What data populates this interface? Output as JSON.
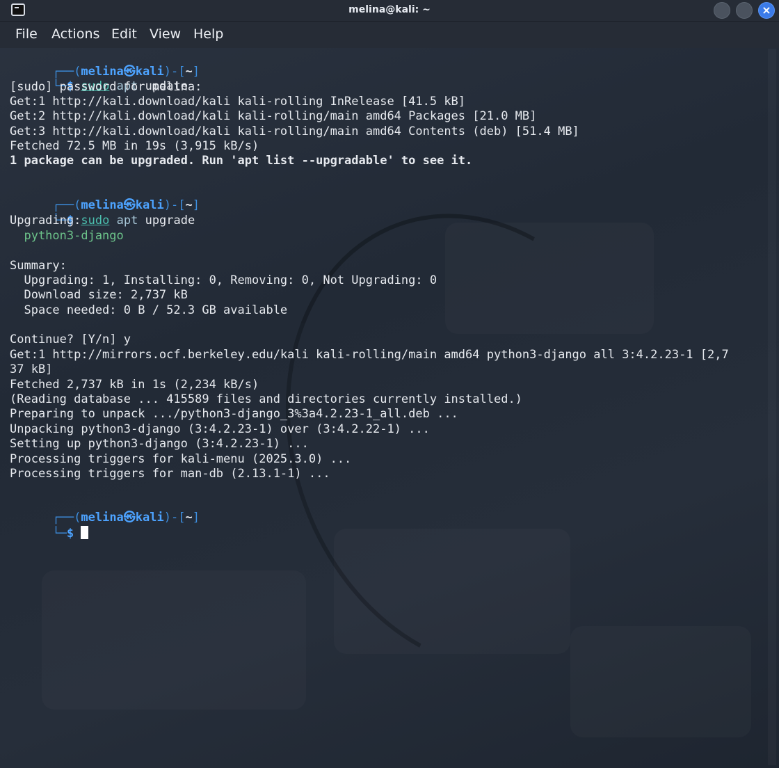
{
  "window": {
    "title": "melina@kali: ~",
    "close_glyph": "×"
  },
  "menu": {
    "file": "File",
    "actions": "Actions",
    "edit": "Edit",
    "view": "View",
    "help": "Help"
  },
  "prompt": {
    "open": "┌──(",
    "user": "melina",
    "at": "㉿",
    "host": "kali",
    "mid": ")-[",
    "dir": "~",
    "close": "]",
    "corner": "└─",
    "dollar": "$"
  },
  "cmd1": {
    "sudo": "sudo",
    "apt": "apt",
    "arg": "update"
  },
  "cmd2": {
    "sudo": "sudo",
    "apt": "apt",
    "arg": "upgrade"
  },
  "output1": [
    "[sudo] password for melina:",
    "Get:1 http://kali.download/kali kali-rolling InRelease [41.5 kB]",
    "Get:2 http://kali.download/kali kali-rolling/main amd64 Packages [21.0 MB]",
    "Get:3 http://kali.download/kali kali-rolling/main amd64 Contents (deb) [51.4 MB]",
    "Fetched 72.5 MB in 19s (3,915 kB/s)"
  ],
  "output1_bold": "1 package can be upgraded. Run 'apt list --upgradable' to see it.",
  "output2": {
    "upgrading_header": "Upgrading:",
    "package": "  python3-django",
    "summary_header": "Summary:",
    "summary_lines": [
      "  Upgrading: 1, Installing: 0, Removing: 0, Not Upgrading: 0",
      "  Download size: 2,737 kB",
      "  Space needed: 0 B / 52.3 GB available"
    ],
    "continue": "Continue? [Y/n] y",
    "install_lines": [
      "Get:1 http://mirrors.ocf.berkeley.edu/kali kali-rolling/main amd64 python3-django all 3:4.2.23-1 [2,7",
      "37 kB]",
      "Fetched 2,737 kB in 1s (2,234 kB/s)",
      "(Reading database ... 415589 files and directories currently installed.)",
      "Preparing to unpack .../python3-django_3%3a4.2.23-1_all.deb ...",
      "Unpacking python3-django (3:4.2.23-1) over (3:4.2.22-1) ...",
      "Setting up python3-django (3:4.2.23-1) ...",
      "Processing triggers for kali-menu (2025.3.0) ...",
      "Processing triggers for man-db (2.13.1-1) ..."
    ]
  }
}
